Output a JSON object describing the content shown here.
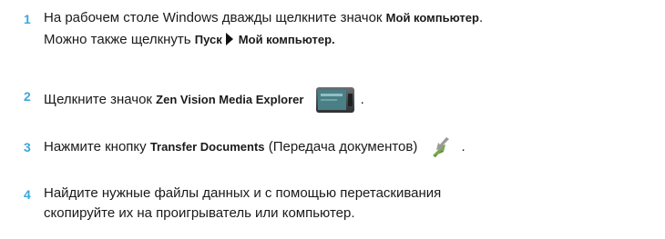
{
  "steps": [
    {
      "number": "1",
      "line1": {
        "text": "На рабочем столе Windows дважды щелкните значок ",
        "bold": "Мой компьютер",
        "end": "."
      },
      "line2": {
        "text": "Можно также щелкнуть ",
        "bold1": "Пуск",
        "bold2": "Мой компьютер."
      }
    },
    {
      "number": "2",
      "text": "Щелкните значок ",
      "bold": "Zen Vision Media Explorer",
      "icon": "player-icon",
      "end": "."
    },
    {
      "number": "3",
      "text": "Нажмите кнопку ",
      "bold": "Transfer Documents",
      "rest": " (Передача документов)",
      "icon": "transfer-icon",
      "end": "."
    },
    {
      "number": "4",
      "line1": "Найдите нужные файлы данных и с помощью перетаскивания",
      "line2": "скопируйте их на проигрыватель или компьютер."
    }
  ],
  "colors": {
    "step_number": "#39a9dc",
    "text": "#1a1a1a"
  }
}
